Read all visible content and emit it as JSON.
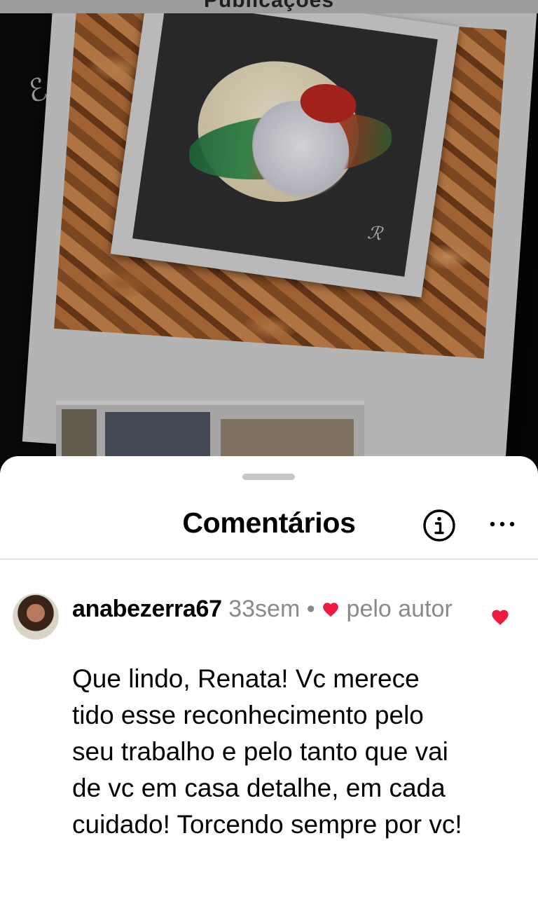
{
  "header": {
    "title": "Publicações"
  },
  "sheet": {
    "title": "Comentários",
    "info_icon": "info-icon",
    "more_icon": "more-icon"
  },
  "comments": [
    {
      "username": "anabezerra67",
      "time": "33sem",
      "separator": "•",
      "liked_by_author_label": "pelo autor",
      "text": "Que lindo, Renata! Vc merece tido esse reconhecimento pelo seu trabalho e pelo tanto que vai de vc em casa detalhe, em cada cuidado! Torcendo sempre por vc!",
      "liked": true
    }
  ],
  "colors": {
    "heart": "#ed1c3e",
    "meta": "#8a8a8e",
    "divider": "#e3e3e3"
  }
}
